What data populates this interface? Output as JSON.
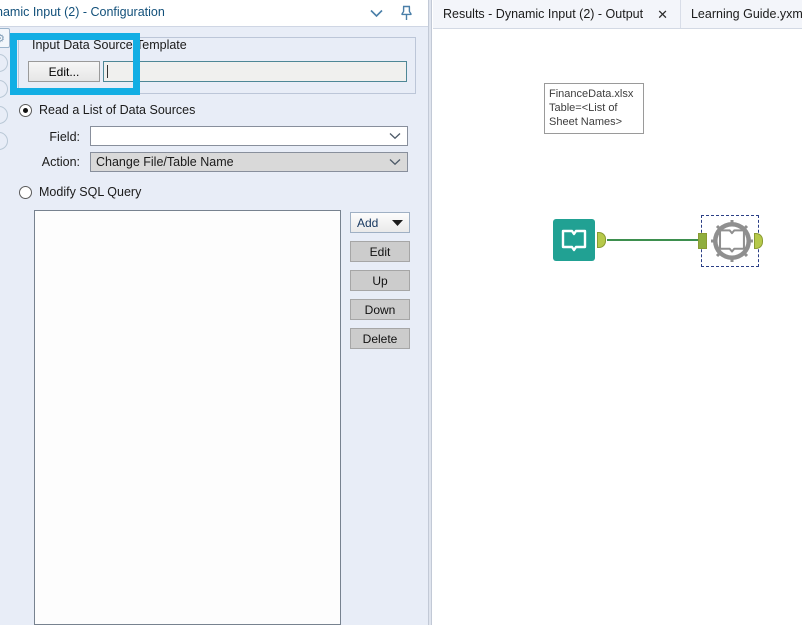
{
  "config_panel": {
    "title": "namic Input (2) - Configuration",
    "header_icons": {
      "collapse": "chevron-down-icon",
      "pin": "pin-icon"
    },
    "group": {
      "legend": "Input Data Source Template",
      "edit_button": "Edit...",
      "template_value": "",
      "template_placeholder": ""
    },
    "mode_read": {
      "label": "Read a List of Data Sources",
      "selected": true
    },
    "mode_sql": {
      "label": "Modify SQL Query",
      "selected": false
    },
    "field": {
      "label": "Field:",
      "value": "",
      "placeholder": ""
    },
    "action": {
      "label": "Action:",
      "value": "Change File/Table Name"
    },
    "list_items": [],
    "side_buttons": [
      {
        "label": "Add",
        "has_dropdown": true
      },
      {
        "label": "Edit",
        "has_dropdown": false
      },
      {
        "label": "Up",
        "has_dropdown": false
      },
      {
        "label": "Down",
        "has_dropdown": false
      },
      {
        "label": "Delete",
        "has_dropdown": false
      }
    ],
    "annotation_color": "#12aee4"
  },
  "right_pane": {
    "tabs": [
      {
        "label": "Results - Dynamic Input (2) - Output",
        "close": "✕",
        "active": true
      },
      {
        "label": "Learning Guide.yxmd",
        "close": "✕",
        "active": false
      }
    ],
    "canvas": {
      "nodes": [
        {
          "name": "input-data-tool",
          "icon": "book-icon",
          "color": "#21a193",
          "selected": false
        },
        {
          "name": "dynamic-input-tool",
          "icon": "gear-book-icon",
          "color": "#8a8a8a",
          "selected": true
        }
      ],
      "annotation": {
        "line1": "FinanceData.xlsx",
        "line2": "Table=<List of",
        "line3": "Sheet Names>"
      }
    }
  }
}
